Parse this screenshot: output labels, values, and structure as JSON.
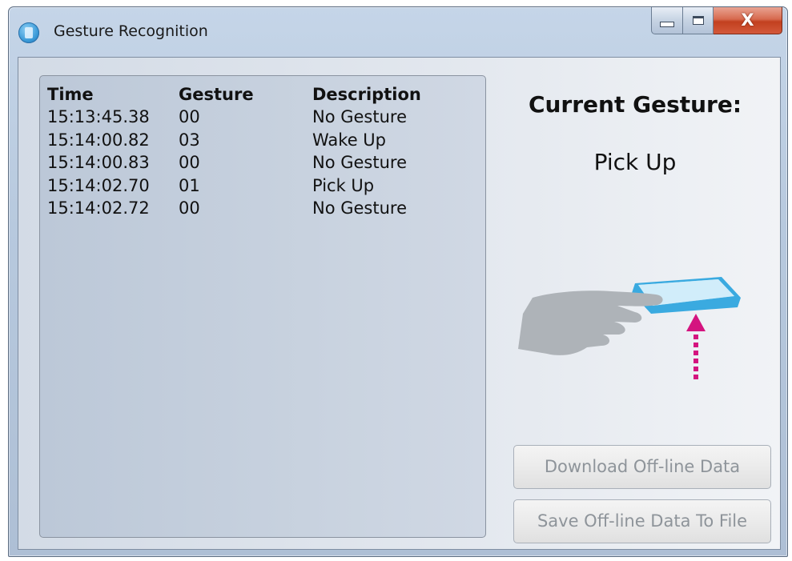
{
  "window": {
    "title": "Gesture Recognition",
    "icon": "app-icon",
    "caption_buttons": {
      "minimize_icon": "minimize-icon",
      "maximize_icon": "maximize-icon",
      "close_label": "X"
    }
  },
  "log": {
    "headers": {
      "time": "Time",
      "gesture": "Gesture",
      "description": "Description"
    },
    "rows": [
      {
        "time": "15:13:45.38",
        "gesture": "00",
        "description": "No Gesture"
      },
      {
        "time": "15:14:00.82",
        "gesture": "03",
        "description": "Wake Up"
      },
      {
        "time": "15:14:00.83",
        "gesture": "00",
        "description": "No Gesture"
      },
      {
        "time": "15:14:02.70",
        "gesture": "01",
        "description": "Pick Up"
      },
      {
        "time": "15:14:02.72",
        "gesture": "00",
        "description": "No Gesture"
      }
    ]
  },
  "current": {
    "label": "Current Gesture:",
    "value": "Pick Up",
    "illustration_icon": "hand-pick-up-icon"
  },
  "buttons": {
    "download_label": "Download Off-line Data",
    "save_label": "Save Off-line Data To File",
    "enabled": false
  },
  "colors": {
    "accent_blue": "#3aaae0",
    "arrow_magenta": "#d4147f",
    "hand_gray": "#aeb3b8",
    "disabled_text": "#8e949a"
  }
}
